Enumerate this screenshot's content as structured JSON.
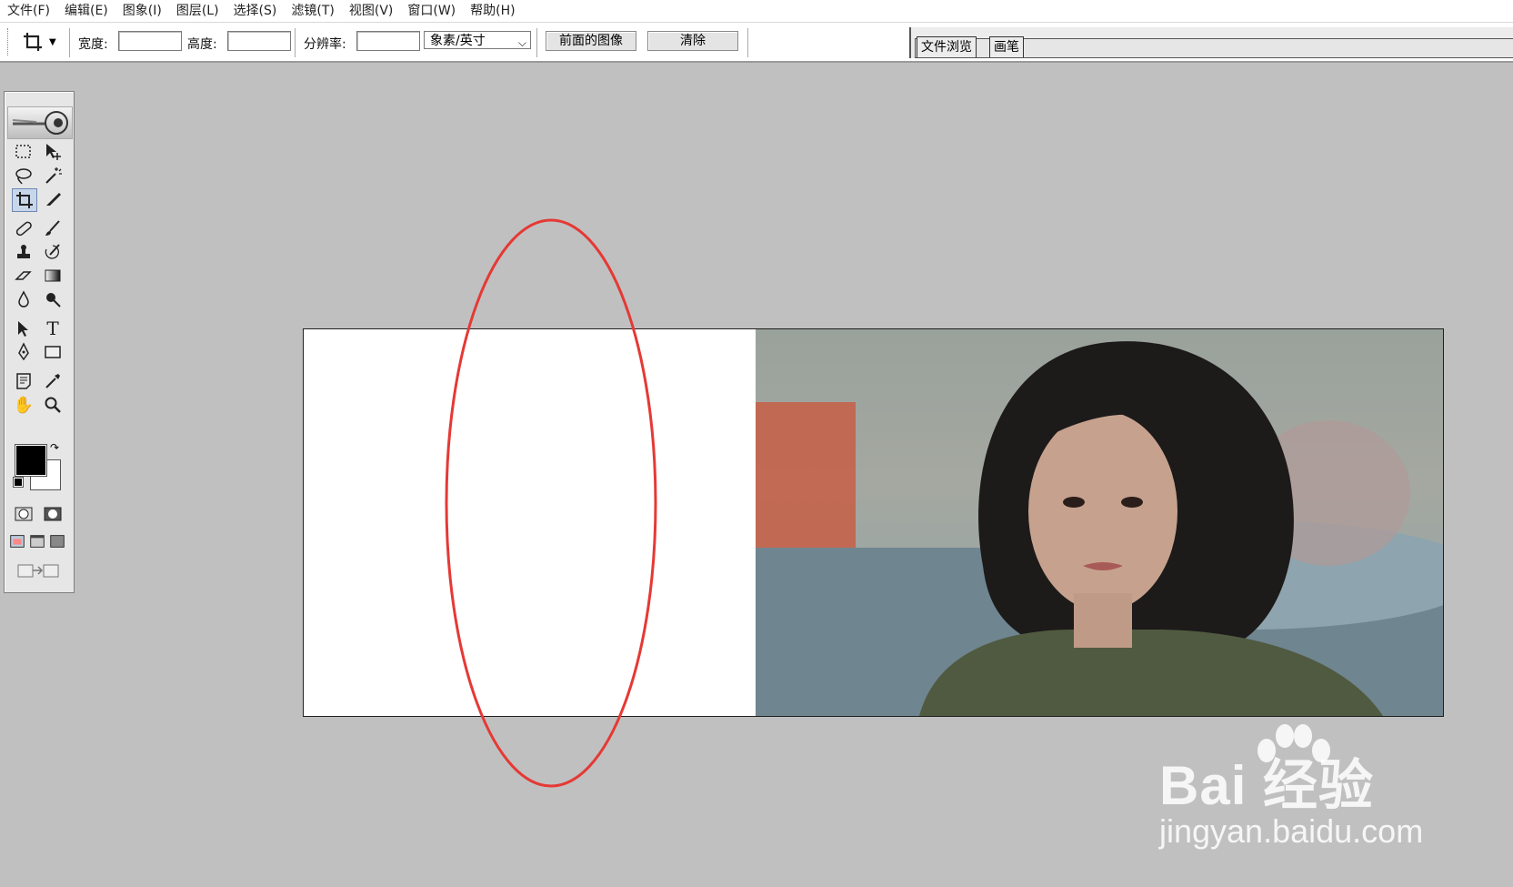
{
  "menu": [
    "文件(F)",
    "编辑(E)",
    "图象(I)",
    "图层(L)",
    "选择(S)",
    "滤镜(T)",
    "视图(V)",
    "窗口(W)",
    "帮助(H)"
  ],
  "options": {
    "width_label": "宽度:",
    "width_value": "",
    "height_label": "高度:",
    "height_value": "",
    "resolution_label": "分辨率:",
    "resolution_value": "",
    "unit_selected": "象素/英寸",
    "front_image_button": "前面的图像",
    "clear_button": "清除"
  },
  "palette_well": {
    "tabs": [
      "文件浏览",
      "画笔"
    ]
  },
  "toolbox": {
    "tools": [
      "rectangular-marquee",
      "move",
      "lasso",
      "magic-wand",
      "crop",
      "slice",
      "healing-brush",
      "brush",
      "clone-stamp",
      "history-brush",
      "eraser",
      "gradient",
      "blur",
      "dodge",
      "path-selection",
      "type",
      "pen",
      "rectangle-shape",
      "notes",
      "eyedropper",
      "hand",
      "zoom"
    ],
    "active_tool": "crop",
    "foreground_color": "#000000",
    "background_color": "#ffffff"
  },
  "annotation": {
    "shape": "ellipse",
    "color": "#e53935"
  },
  "watermark": {
    "logo": "Bai 经验",
    "url": "jingyan.baidu.com"
  }
}
